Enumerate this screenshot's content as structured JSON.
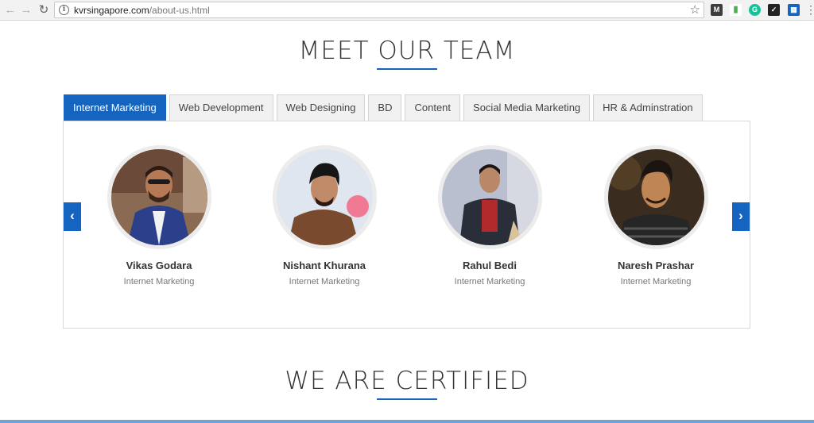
{
  "browser": {
    "url_host": "kvrsingapore.com",
    "url_path": "/about-us.html",
    "icons": [
      "back-icon",
      "forward-icon",
      "reload-icon",
      "info-icon",
      "star-icon",
      "menu-icon"
    ]
  },
  "team": {
    "title": "MEET OUR TEAM",
    "tabs": [
      {
        "label": "Internet Marketing",
        "active": true
      },
      {
        "label": "Web Development"
      },
      {
        "label": "Web Designing"
      },
      {
        "label": "BD"
      },
      {
        "label": "Content"
      },
      {
        "label": "Social Media Marketing"
      },
      {
        "label": "HR & Adminstration"
      }
    ],
    "members": [
      {
        "name": "Vikas Godara",
        "role": "Internet Marketing"
      },
      {
        "name": "Nishant Khurana",
        "role": "Internet Marketing"
      },
      {
        "name": "Rahul Bedi",
        "role": "Internet Marketing"
      },
      {
        "name": "Naresh Prashar",
        "role": "Internet Marketing"
      }
    ],
    "accent_color": "#1565c0"
  },
  "certified": {
    "title": "WE ARE CERTIFIED"
  }
}
